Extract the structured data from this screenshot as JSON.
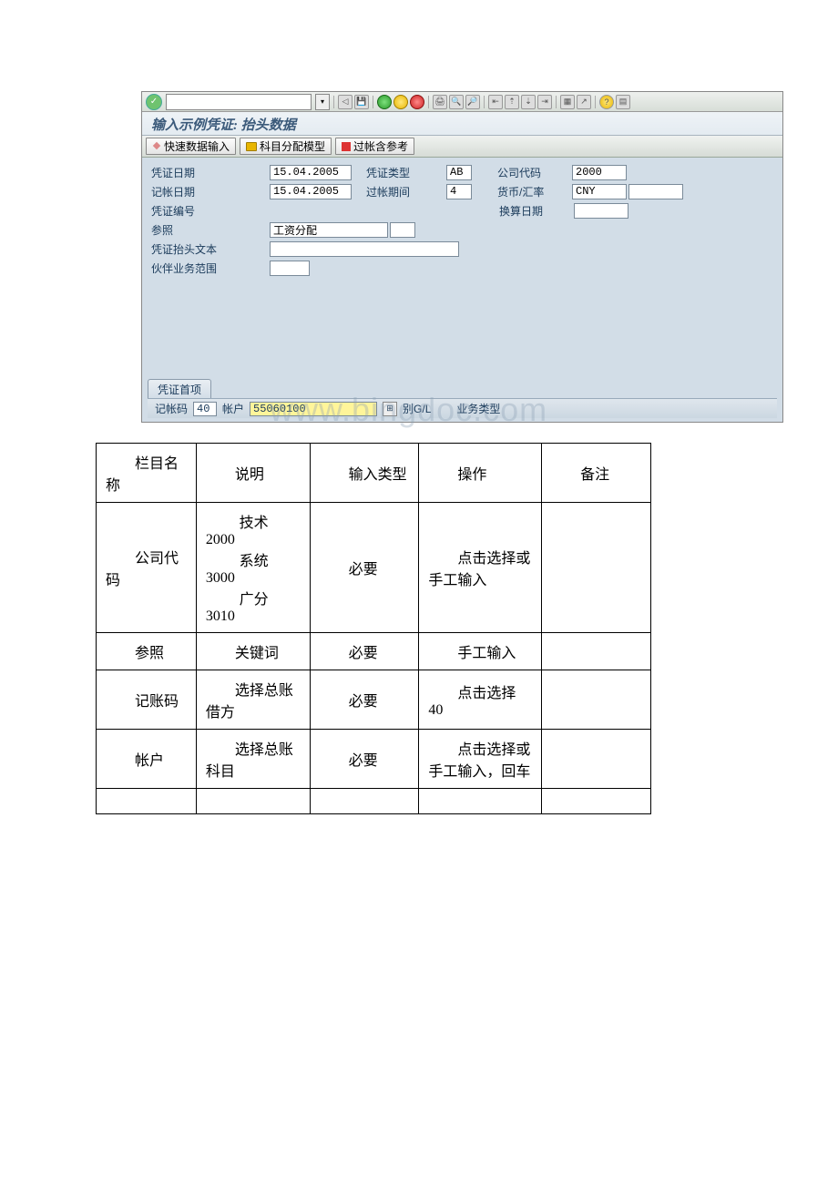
{
  "sap": {
    "title": "输入示例凭证: 抬头数据",
    "toolbar2": {
      "btn1": "快速数据输入",
      "btn2": "科目分配模型",
      "btn3": "过帐含参考"
    },
    "form": {
      "r1": {
        "l1": "凭证日期",
        "v1": "15.04.2005",
        "l2": "凭证类型",
        "v2": "AB",
        "l3": "公司代码",
        "v3": "2000"
      },
      "r2": {
        "l1": "记帐日期",
        "v1": "15.04.2005",
        "l2": "过帐期间",
        "v2": "4",
        "l3": "货币/汇率",
        "v3": "CNY"
      },
      "r3": {
        "l1": "凭证编号",
        "l3": "换算日期"
      },
      "r4": {
        "l1": "参照",
        "v1": "工资分配"
      },
      "r5": {
        "l1": "凭证抬头文本"
      },
      "r6": {
        "l1": "伙伴业务范围"
      }
    },
    "tab": "凭证首项",
    "bottom": {
      "l1": "记帐码",
      "v1": "40",
      "l2": "帐户",
      "v2": "55060100",
      "l3": "别G/L",
      "l4": "业务类型"
    }
  },
  "watermark": "www.bingdoc.com",
  "table": {
    "headers": {
      "c1": "栏目名称",
      "c2": "说明",
      "c3": "输入类型",
      "c4": "操作",
      "c5": "备注"
    },
    "rows": [
      {
        "c1": "公司代码",
        "c2": "技术 2000\n系统 3000\n广分 3010",
        "c3": "必要",
        "c4": "点击选择或手工输入",
        "c5": ""
      },
      {
        "c1": "参照",
        "c2": "关键词",
        "c3": "必要",
        "c4": "手工输入",
        "c5": ""
      },
      {
        "c1": "记账码",
        "c2": "选择总账借方",
        "c3": "必要",
        "c4": "点击选择 40",
        "c5": ""
      },
      {
        "c1": "帐户",
        "c2": "选择总账科目",
        "c3": "必要",
        "c4": "点击选择或手工输入，回车",
        "c5": ""
      },
      {
        "c1": "",
        "c2": "",
        "c3": "",
        "c4": "",
        "c5": ""
      }
    ]
  }
}
